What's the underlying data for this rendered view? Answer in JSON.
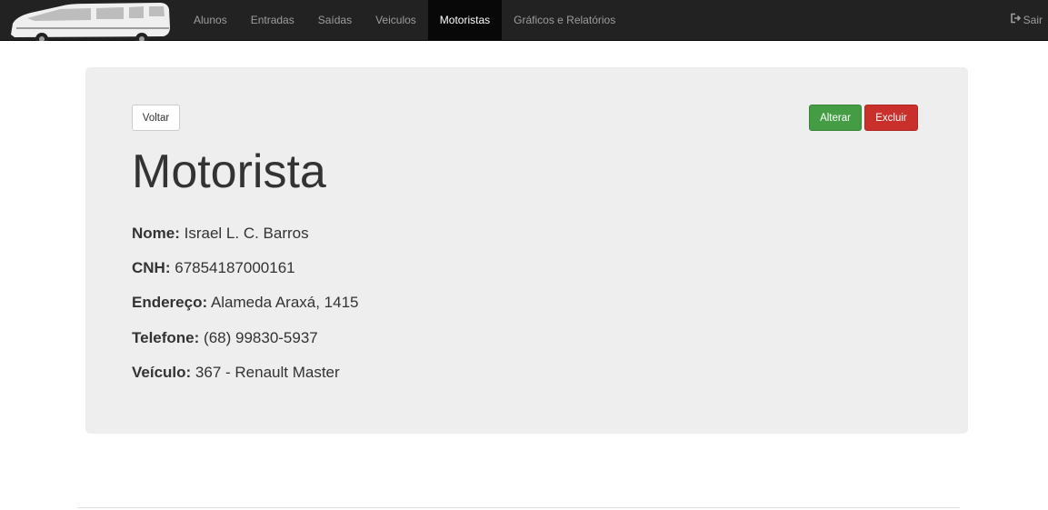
{
  "nav": {
    "brand_icon": "van-logo-icon",
    "links": [
      "Alunos",
      "Entradas",
      "Saídas",
      "Veiculos",
      "Motoristas",
      "Gráficos e Relatórios"
    ],
    "active": "Motoristas",
    "logout_label": "Sair",
    "logout_icon": "sign-out-icon"
  },
  "panel": {
    "back_label": "Voltar",
    "edit_label": "Alterar",
    "delete_label": "Excluir",
    "title": "Motorista",
    "fields": [
      {
        "label": "Nome:",
        "value": "Israel L. C. Barros"
      },
      {
        "label": "CNH:",
        "value": "67854187000161"
      },
      {
        "label": "Endereço:",
        "value": "Alameda Araxá, 1415"
      },
      {
        "label": "Telefone:",
        "value": "(68) 99830-5937"
      },
      {
        "label": "Veículo:",
        "value": "367 - Renault Master"
      }
    ]
  },
  "colors": {
    "navbar": "#222222",
    "active_tab": "#080808",
    "panel": "#eeeeee",
    "success": "#449d44",
    "danger": "#c9302c"
  }
}
